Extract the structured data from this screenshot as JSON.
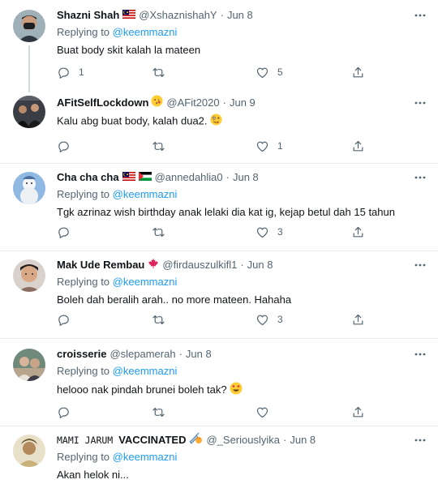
{
  "reply_prefix": "Replying to",
  "icons": {
    "reply": "reply-icon",
    "retweet": "retweet-icon",
    "like": "heart-icon",
    "share": "share-icon",
    "more": "more-icon"
  },
  "colors": {
    "link": "#1d9bf0",
    "muted": "#536471",
    "text": "#0f1419",
    "divider": "#e6ecf0"
  },
  "tweets": [
    {
      "display_name": "Shazni Shah",
      "handle": "@XshaznishahY",
      "separator": "·",
      "date": "Jun 8",
      "reply_to": "@keemmazni",
      "text": "Buat body skit kalah la mateen",
      "replies": "1",
      "retweets": "",
      "likes": "5"
    },
    {
      "display_name": "AFitSelfLockdown",
      "handle": "@AFit2020",
      "separator": "·",
      "date": "Jun 9",
      "text": "Kalu abg buat body, kalah dua2.",
      "replies": "",
      "retweets": "",
      "likes": "1"
    },
    {
      "display_name": "Cha cha cha",
      "handle": "@annedahlia0",
      "separator": "·",
      "date": "Jun 8",
      "reply_to": "@keemmazni",
      "text": "Tgk azrinaz wish birthday anak lelaki dia kat ig, kejap betul dah 15 tahun",
      "replies": "",
      "retweets": "",
      "likes": "3"
    },
    {
      "display_name": "Mak Ude Rembau",
      "handle": "@firdauszulkifl1",
      "separator": "·",
      "date": "Jun 8",
      "reply_to": "@keemmazni",
      "text": "Boleh dah beralih arah.. no more mateen. Hahaha",
      "replies": "",
      "retweets": "",
      "likes": "3"
    },
    {
      "display_name": "croisserie",
      "handle": "@slepamerah",
      "separator": "·",
      "date": "Jun 8",
      "reply_to": "@keemmazni",
      "text": "helooo nak pindah brunei boleh tak?",
      "replies": "",
      "retweets": "",
      "likes": ""
    },
    {
      "display_name": "MAMI JARUM",
      "display_name_suffix": "VACCINATED",
      "handle": "@_Seriouslyika",
      "separator": "·",
      "date": "Jun 8",
      "reply_to": "@keemmazni",
      "text": "Akan helok ni..."
    }
  ]
}
